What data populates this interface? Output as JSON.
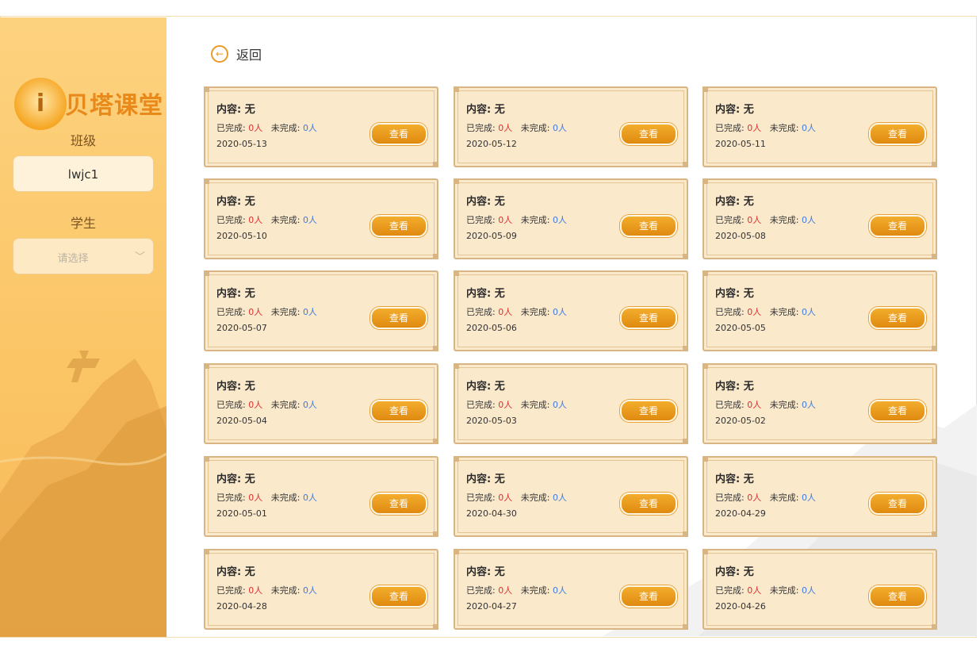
{
  "sidebar": {
    "logo_text": "贝塔课堂",
    "class_label": "班级",
    "class_value": "lwjc1",
    "student_label": "学生",
    "student_placeholder": "请选择"
  },
  "back_label": "返回",
  "colors": {
    "accent": "#f6a623",
    "completed": "#e03030",
    "pending": "#3f7be0"
  },
  "cards": [
    {
      "title": "内容: 无",
      "done_label": "已完成:",
      "done": "0人",
      "todo_label": "未完成:",
      "todo": "0人",
      "date": "2020-05-13",
      "button": "查看"
    },
    {
      "title": "内容: 无",
      "done_label": "已完成:",
      "done": "0人",
      "todo_label": "未完成:",
      "todo": "0人",
      "date": "2020-05-12",
      "button": "查看"
    },
    {
      "title": "内容: 无",
      "done_label": "已完成:",
      "done": "0人",
      "todo_label": "未完成:",
      "todo": "0人",
      "date": "2020-05-11",
      "button": "查看"
    },
    {
      "title": "内容: 无",
      "done_label": "已完成:",
      "done": "0人",
      "todo_label": "未完成:",
      "todo": "0人",
      "date": "2020-05-10",
      "button": "查看"
    },
    {
      "title": "内容: 无",
      "done_label": "已完成:",
      "done": "0人",
      "todo_label": "未完成:",
      "todo": "0人",
      "date": "2020-05-09",
      "button": "查看"
    },
    {
      "title": "内容: 无",
      "done_label": "已完成:",
      "done": "0人",
      "todo_label": "未完成:",
      "todo": "0人",
      "date": "2020-05-08",
      "button": "查看"
    },
    {
      "title": "内容: 无",
      "done_label": "已完成:",
      "done": "0人",
      "todo_label": "未完成:",
      "todo": "0人",
      "date": "2020-05-07",
      "button": "查看"
    },
    {
      "title": "内容: 无",
      "done_label": "已完成:",
      "done": "0人",
      "todo_label": "未完成:",
      "todo": "0人",
      "date": "2020-05-06",
      "button": "查看"
    },
    {
      "title": "内容: 无",
      "done_label": "已完成:",
      "done": "0人",
      "todo_label": "未完成:",
      "todo": "0人",
      "date": "2020-05-05",
      "button": "查看"
    },
    {
      "title": "内容: 无",
      "done_label": "已完成:",
      "done": "0人",
      "todo_label": "未完成:",
      "todo": "0人",
      "date": "2020-05-04",
      "button": "查看"
    },
    {
      "title": "内容: 无",
      "done_label": "已完成:",
      "done": "0人",
      "todo_label": "未完成:",
      "todo": "0人",
      "date": "2020-05-03",
      "button": "查看"
    },
    {
      "title": "内容: 无",
      "done_label": "已完成:",
      "done": "0人",
      "todo_label": "未完成:",
      "todo": "0人",
      "date": "2020-05-02",
      "button": "查看"
    },
    {
      "title": "内容: 无",
      "done_label": "已完成:",
      "done": "0人",
      "todo_label": "未完成:",
      "todo": "0人",
      "date": "2020-05-01",
      "button": "查看"
    },
    {
      "title": "内容: 无",
      "done_label": "已完成:",
      "done": "0人",
      "todo_label": "未完成:",
      "todo": "0人",
      "date": "2020-04-30",
      "button": "查看"
    },
    {
      "title": "内容: 无",
      "done_label": "已完成:",
      "done": "0人",
      "todo_label": "未完成:",
      "todo": "0人",
      "date": "2020-04-29",
      "button": "查看"
    },
    {
      "title": "内容: 无",
      "done_label": "已完成:",
      "done": "0人",
      "todo_label": "未完成:",
      "todo": "0人",
      "date": "2020-04-28",
      "button": "查看"
    },
    {
      "title": "内容: 无",
      "done_label": "已完成:",
      "done": "0人",
      "todo_label": "未完成:",
      "todo": "0人",
      "date": "2020-04-27",
      "button": "查看"
    },
    {
      "title": "内容: 无",
      "done_label": "已完成:",
      "done": "0人",
      "todo_label": "未完成:",
      "todo": "0人",
      "date": "2020-04-26",
      "button": "查看"
    }
  ]
}
